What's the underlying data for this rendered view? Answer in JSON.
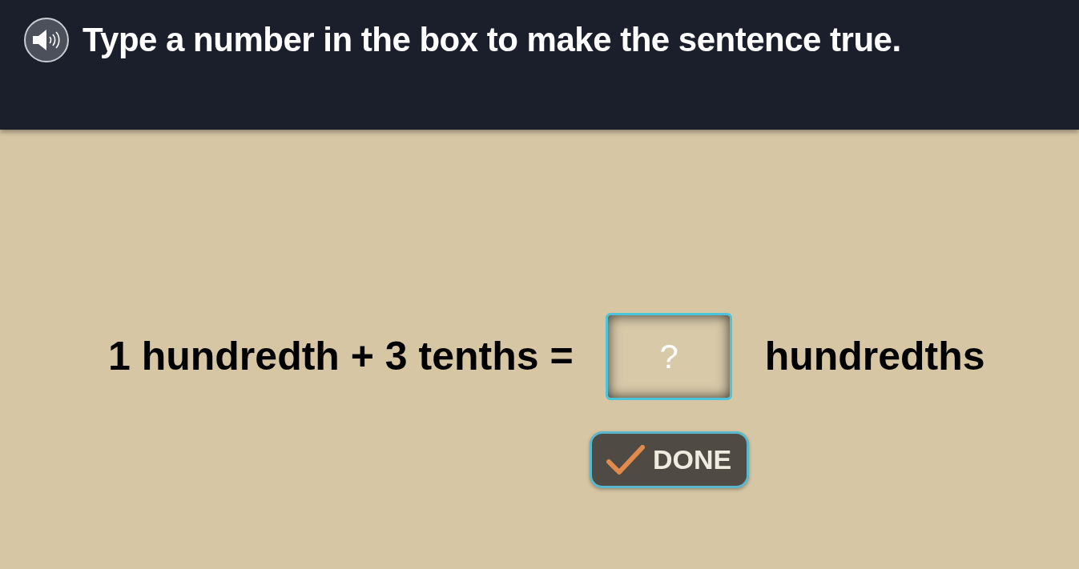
{
  "header": {
    "title": "Type a number in the box to make the sentence true."
  },
  "question": {
    "before": "1 hundredth + 3 tenths =",
    "answer_box": {
      "placeholder": "?"
    },
    "after": "hundredths"
  },
  "done_button": {
    "label": "DONE"
  }
}
